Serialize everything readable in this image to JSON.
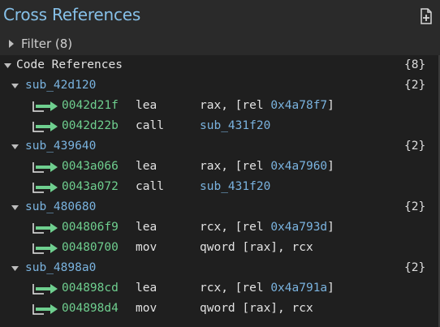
{
  "panel": {
    "title": "Cross References",
    "filter_label": "Filter (8)",
    "code_refs_label": "Code References",
    "code_refs_count": "{8}"
  },
  "groups": [
    {
      "name": "sub_42d120",
      "count": "{2}",
      "refs": [
        {
          "addr": "0042d21f",
          "op": "lea",
          "args_plain": "rax, [rel ",
          "args_hl": "0x4a78f7",
          "args_tail": "]"
        },
        {
          "addr": "0042d22b",
          "op": "call",
          "args_plain": "",
          "args_hl": "sub_431f20",
          "args_tail": ""
        }
      ]
    },
    {
      "name": "sub_439640",
      "count": "{2}",
      "refs": [
        {
          "addr": "0043a066",
          "op": "lea",
          "args_plain": "rax, [rel ",
          "args_hl": "0x4a7960",
          "args_tail": "]"
        },
        {
          "addr": "0043a072",
          "op": "call",
          "args_plain": "",
          "args_hl": "sub_431f20",
          "args_tail": ""
        }
      ]
    },
    {
      "name": "sub_480680",
      "count": "{2}",
      "refs": [
        {
          "addr": "004806f9",
          "op": "lea",
          "args_plain": "rcx, [rel ",
          "args_hl": "0x4a793d",
          "args_tail": "]"
        },
        {
          "addr": "00480700",
          "op": "mov",
          "args_plain": "qword [rax], rcx",
          "args_hl": "",
          "args_tail": ""
        }
      ]
    },
    {
      "name": "sub_4898a0",
      "count": "{2}",
      "refs": [
        {
          "addr": "004898cd",
          "op": "lea",
          "args_plain": "rcx, [rel ",
          "args_hl": "0x4a791a",
          "args_tail": "]"
        },
        {
          "addr": "004898d4",
          "op": "mov",
          "args_plain": "qword [rax], rcx",
          "args_hl": "",
          "args_tail": ""
        }
      ]
    }
  ],
  "colors": {
    "title": "#86c0e8",
    "function": "#7ab3df",
    "address": "#6fcf8f",
    "tree_bg": "#1f1f1f",
    "panel_bg": "#2a2a2a"
  },
  "icons": {
    "title_button": "new-file-icon",
    "xref": "xref-arrow-icon",
    "expand": "triangle-icon"
  }
}
